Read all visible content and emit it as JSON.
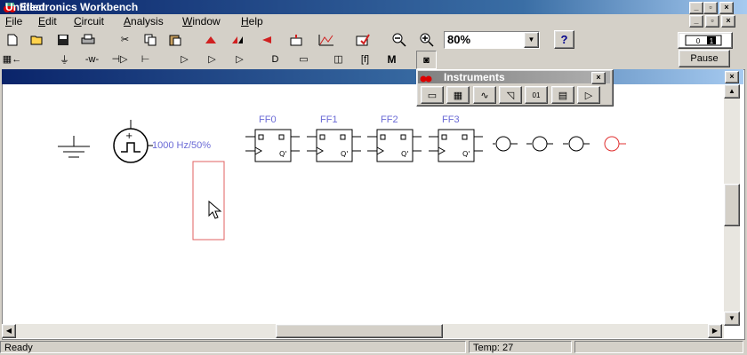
{
  "app": {
    "title": "Electronics Workbench"
  },
  "menu": [
    {
      "label": "File",
      "ul": "F"
    },
    {
      "label": "Edit",
      "ul": "E"
    },
    {
      "label": "Circuit",
      "ul": "C"
    },
    {
      "label": "Analysis",
      "ul": "A"
    },
    {
      "label": "Window",
      "ul": "W"
    },
    {
      "label": "Help",
      "ul": "H"
    }
  ],
  "toolbar": {
    "zoom_value": "80%",
    "help_label": "?",
    "pause_label": "Pause",
    "m_label": "M"
  },
  "document": {
    "title": "Untitled"
  },
  "instruments": {
    "title": "Instruments"
  },
  "circuit": {
    "source_label": "1000 Hz/50%",
    "flipflops": [
      "FF0",
      "FF1",
      "FF2",
      "FF3"
    ]
  },
  "status": {
    "left": "Ready",
    "temp": "Temp:  27"
  },
  "colors": {
    "selection": "#e06060",
    "label": "#6b6bd6"
  }
}
